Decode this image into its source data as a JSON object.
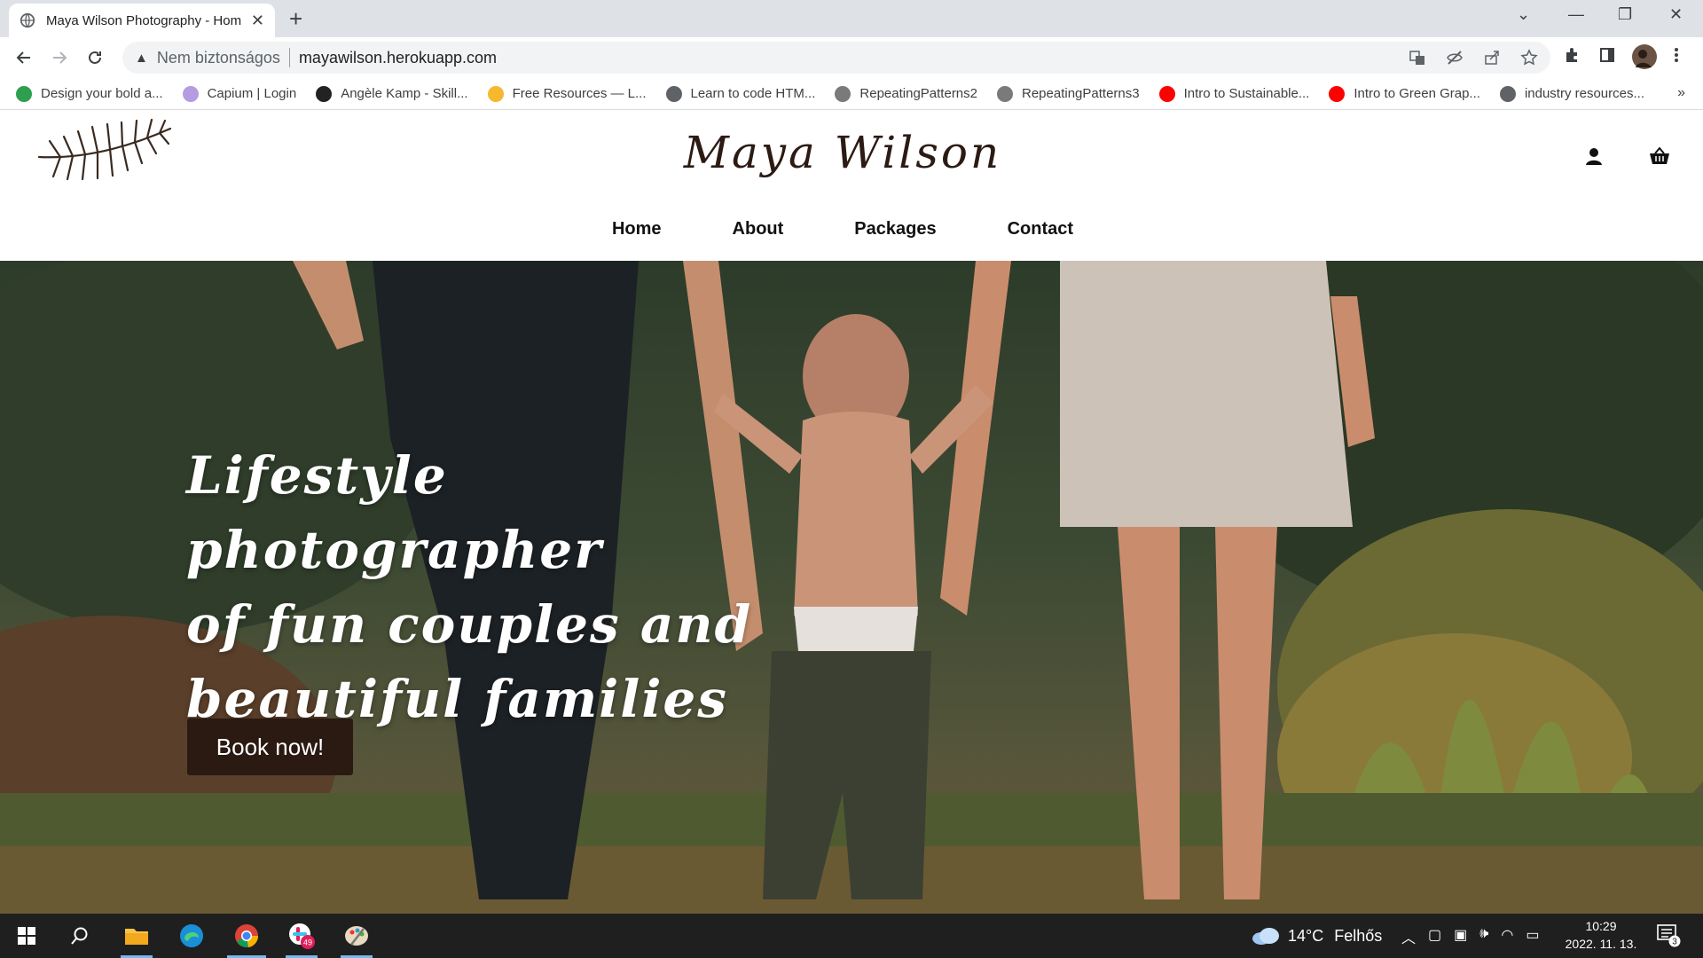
{
  "browser": {
    "tab_title": "Maya Wilson Photography - Hom",
    "new_tab": "+",
    "security_label": "Nem biztonságos",
    "url": "mayawilson.herokuapp.com",
    "bookmarks": [
      {
        "label": "Design your bold a...",
        "icon": "green-f-icon",
        "color": "#2e9e4f"
      },
      {
        "label": "Capium | Login",
        "icon": "capium-icon",
        "color": "#b59be0"
      },
      {
        "label": "Angèle Kamp - Skill...",
        "icon": "sk-icon",
        "color": "#222222"
      },
      {
        "label": "Free Resources — L...",
        "icon": "yellow-dot-icon",
        "color": "#f5b82e"
      },
      {
        "label": "Learn to code HTM...",
        "icon": "globe-icon",
        "color": "#5f6368"
      },
      {
        "label": "RepeatingPatterns2",
        "icon": "pattern-icon",
        "color": "#7a7a7a"
      },
      {
        "label": "RepeatingPatterns3",
        "icon": "pattern-icon",
        "color": "#7a7a7a"
      },
      {
        "label": "Intro to Sustainable...",
        "icon": "youtube-icon",
        "color": "#ff0000"
      },
      {
        "label": "Intro to Green Grap...",
        "icon": "youtube-icon",
        "color": "#ff0000"
      },
      {
        "label": "industry resources...",
        "icon": "globe-icon",
        "color": "#5f6368"
      }
    ],
    "bookmarks_more": "»"
  },
  "site": {
    "title": "Maya Wilson",
    "nav": [
      "Home",
      "About",
      "Packages",
      "Contact"
    ],
    "hero_lines": [
      "Lifestyle photographer",
      "of fun couples and",
      "beautiful families"
    ],
    "cta": "Book now!",
    "brand_color": "#2b1a12"
  },
  "taskbar": {
    "weather_temp": "14°C",
    "weather_desc": "Felhős",
    "time": "10:29",
    "date": "2022. 11. 13.",
    "slack_badge": "49",
    "notifications": "3"
  }
}
